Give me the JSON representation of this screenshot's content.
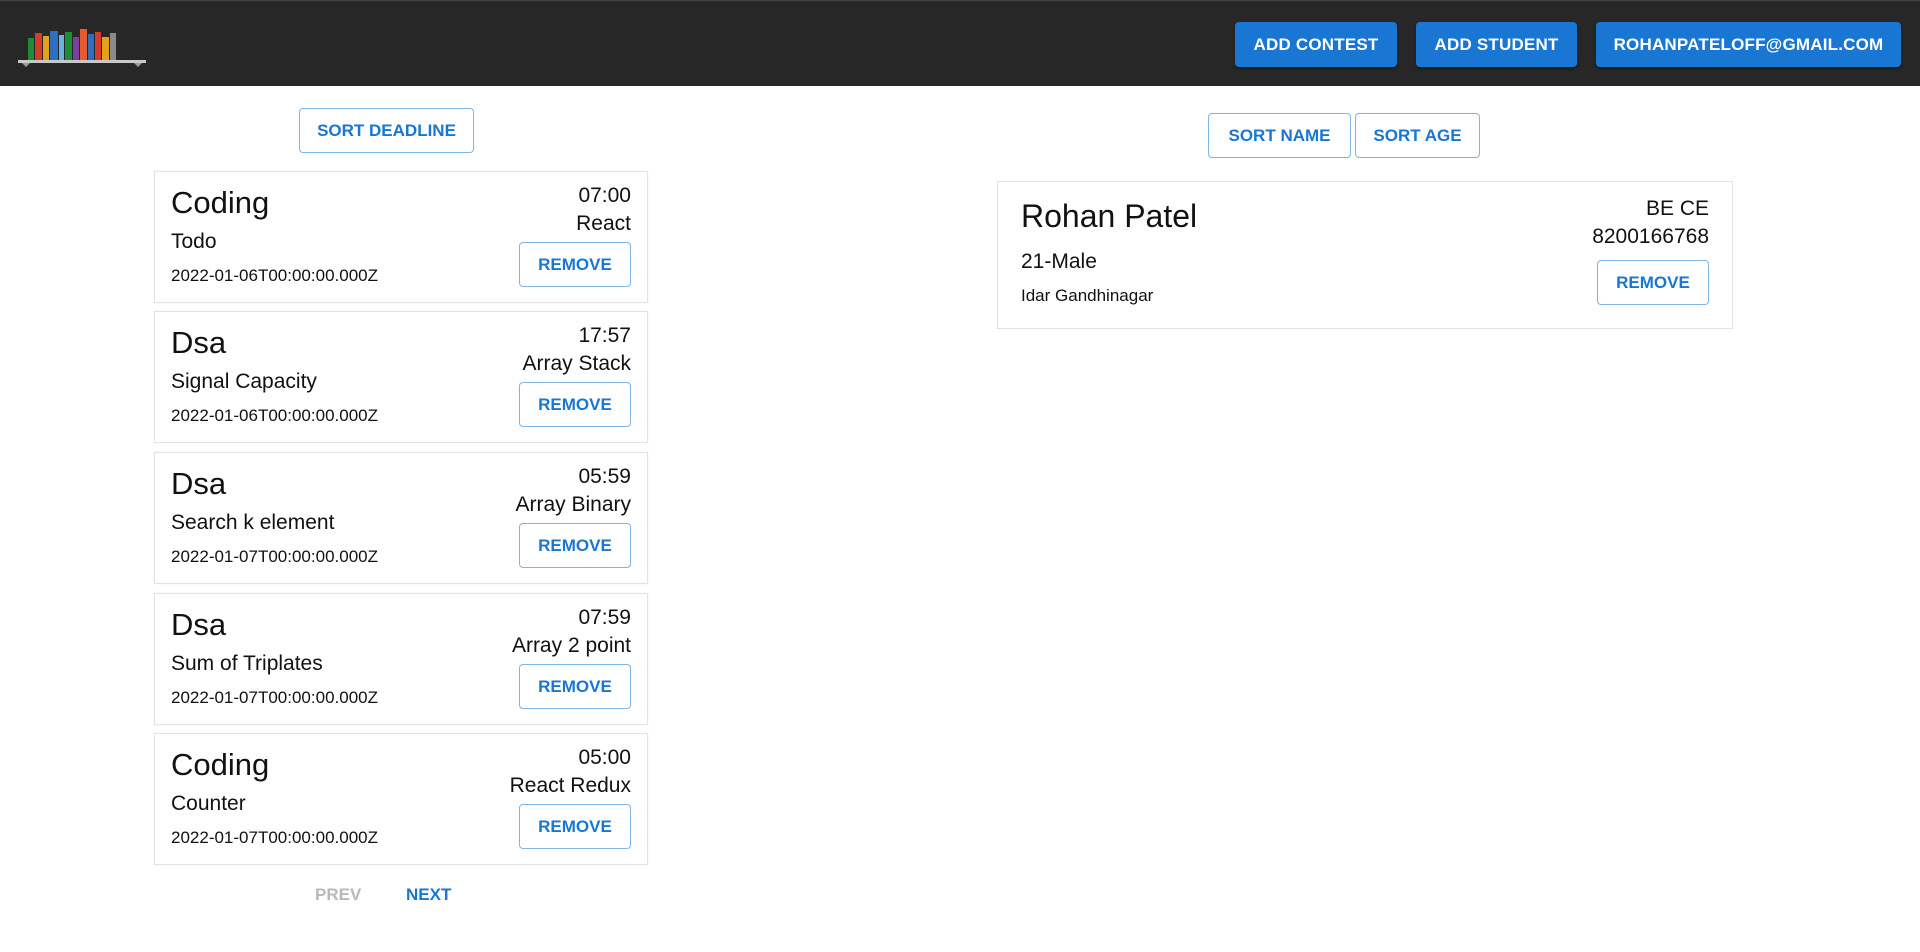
{
  "header": {
    "logo_icon": "bookshelf-logo",
    "add_contest_label": "ADD CONTEST",
    "add_student_label": "ADD STUDENT",
    "user_email_label": "ROHANPATELOFF@GMAIL.COM"
  },
  "contests": {
    "sort_label": "SORT DEADLINE",
    "items": [
      {
        "title": "Coding",
        "subtitle": "Todo",
        "date": "2022-01-06T00:00:00.000Z",
        "time": "07:00",
        "tag": "React",
        "remove_label": "REMOVE"
      },
      {
        "title": "Dsa",
        "subtitle": "Signal Capacity",
        "date": "2022-01-06T00:00:00.000Z",
        "time": "17:57",
        "tag": "Array Stack",
        "remove_label": "REMOVE"
      },
      {
        "title": "Dsa",
        "subtitle": "Search k element",
        "date": "2022-01-07T00:00:00.000Z",
        "time": "05:59",
        "tag": "Array Binary",
        "remove_label": "REMOVE"
      },
      {
        "title": "Dsa",
        "subtitle": "Sum of Triplates",
        "date": "2022-01-07T00:00:00.000Z",
        "time": "07:59",
        "tag": "Array 2 point",
        "remove_label": "REMOVE"
      },
      {
        "title": "Coding",
        "subtitle": "Counter",
        "date": "2022-01-07T00:00:00.000Z",
        "time": "05:00",
        "tag": "React Redux",
        "remove_label": "REMOVE"
      }
    ],
    "pager": {
      "prev_label": "PREV",
      "next_label": "NEXT"
    }
  },
  "students": {
    "sort_name_label": "SORT NAME",
    "sort_age_label": "SORT AGE",
    "items": [
      {
        "name": "Rohan Patel",
        "age_gender": "21-Male",
        "address": "Idar Gandhinagar",
        "course": "BE CE",
        "phone": "8200166768",
        "remove_label": "REMOVE"
      }
    ]
  },
  "colors": {
    "primary": "#1976d2",
    "topbar": "#272727",
    "disabled": "#b8b8b8"
  }
}
